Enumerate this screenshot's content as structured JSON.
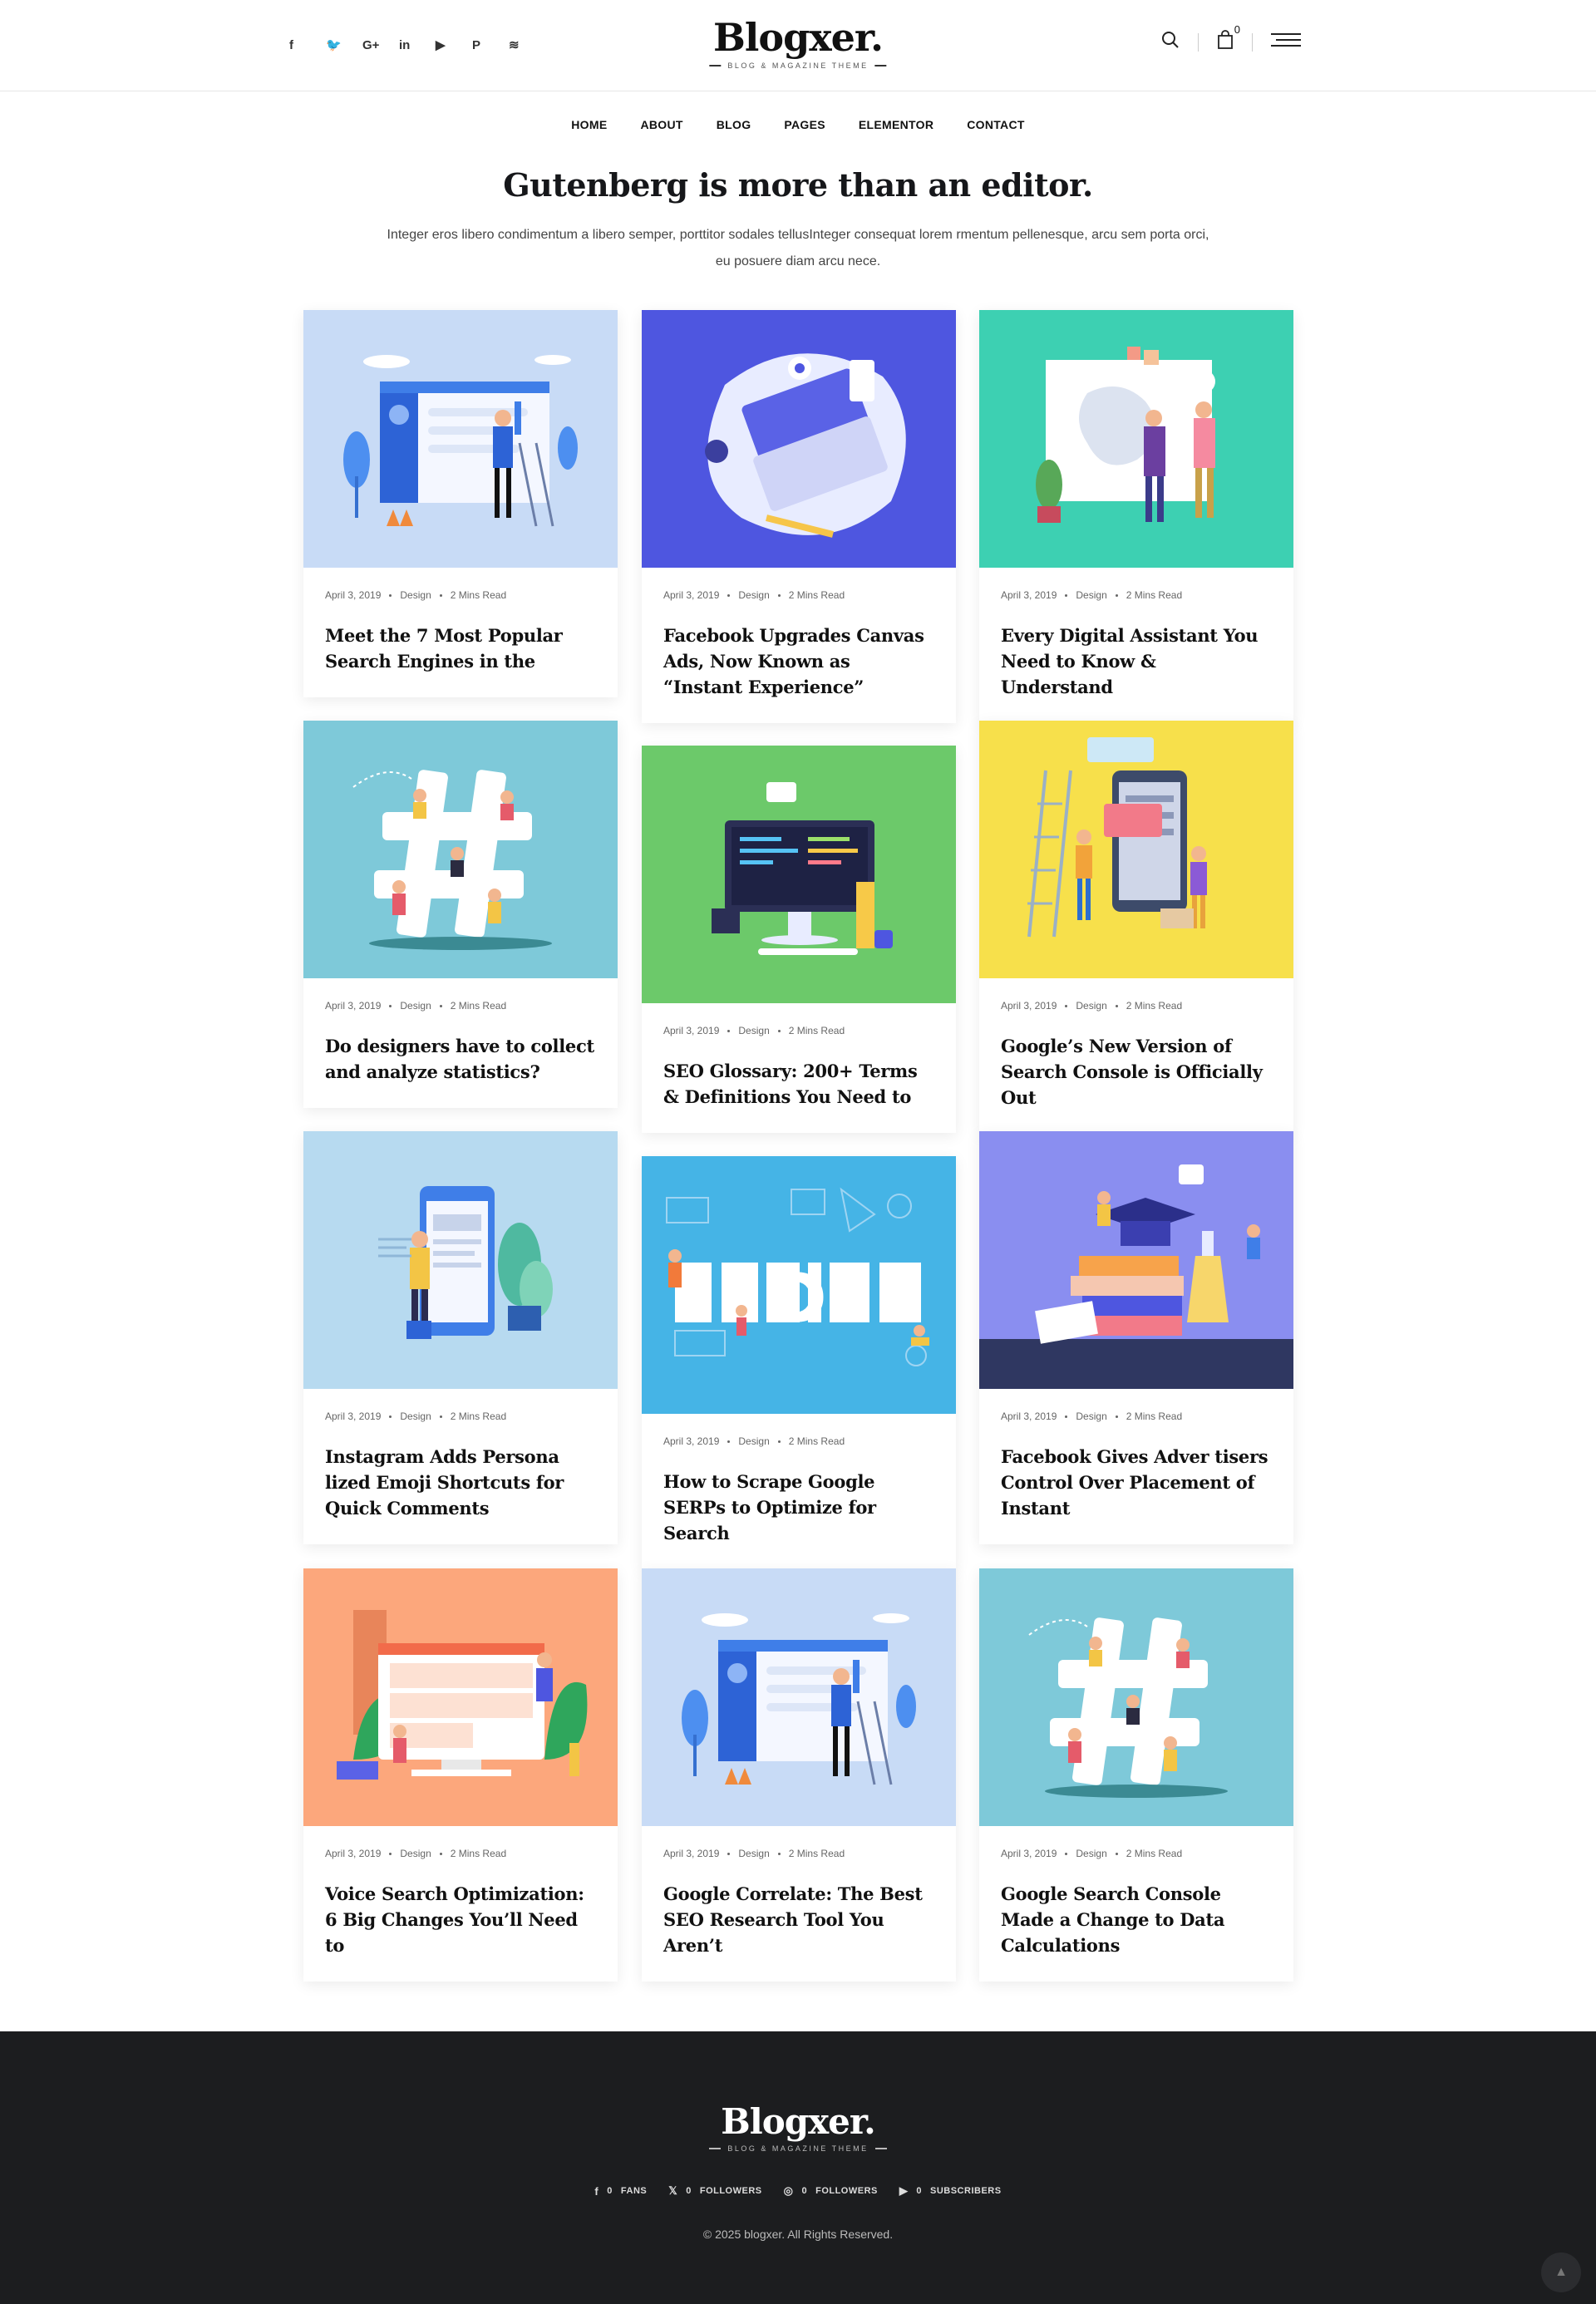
{
  "header": {
    "social_icons": [
      "facebook-icon",
      "twitter-icon",
      "google-plus-icon",
      "linkedin-icon",
      "youtube-icon",
      "pinterest-icon",
      "rss-icon"
    ],
    "social_glyphs": [
      "f",
      "🐦",
      "G+",
      "in",
      "▶",
      "P",
      "≋"
    ],
    "logo": "Blogxer.",
    "logo_tagline": "BLOG & MAGAZINE THEME",
    "cart_count": "0"
  },
  "nav": [
    "HOME",
    "ABOUT",
    "BLOG",
    "PAGES",
    "ELEMENTOR",
    "CONTACT"
  ],
  "hero": {
    "title": "Gutenberg is more than an editor.",
    "text": "Integer eros libero condimentum a libero semper, porttitor sodales tellusInteger consequat lorem rmentum pellenesque, arcu sem porta orci, eu posuere diam arcu nece."
  },
  "posts": [
    {
      "date": "April 3, 2019",
      "category": "Design",
      "read": "2 Mins Read",
      "title": "Meet the 7 Most Popular Search Engines in the",
      "thumb_color": "#c8dbf6",
      "art": "browser-painter"
    },
    {
      "date": "April 3, 2019",
      "category": "Design",
      "read": "2 Mins Read",
      "title": "Facebook Upgrades Canvas Ads, Now Known as “Instant Experience”",
      "thumb_color": "#4e56e0",
      "art": "laptop"
    },
    {
      "date": "April 3, 2019",
      "category": "Design",
      "read": "2 Mins Read",
      "title": "Every Digital Assistant You Need to Know & Understand",
      "thumb_color": "#3dd0b2",
      "art": "canvas-people"
    },
    {
      "date": "April 3, 2019",
      "category": "Design",
      "read": "2 Mins Read",
      "title": "Do designers have to collect and analyze statistics?",
      "thumb_color": "#7ec9d9",
      "art": "hashtag"
    },
    {
      "date": "April 3, 2019",
      "category": "Design",
      "read": "2 Mins Read",
      "title": "SEO Glossary: 200+ Terms & Definitions You Need to",
      "thumb_color": "#6cc96a",
      "art": "monitor-code"
    },
    {
      "date": "April 3, 2019",
      "category": "Design",
      "read": "2 Mins Read",
      "title": "Google’s New Version of Search Console is Officially Out",
      "thumb_color": "#f7e04b",
      "art": "phone-ladder"
    },
    {
      "date": "April 3, 2019",
      "category": "Design",
      "read": "2 Mins Read",
      "title": "Instagram Adds Persona lized Emoji Shortcuts for Quick Comments",
      "thumb_color": "#b7daf0",
      "art": "tablet-plant"
    },
    {
      "date": "April 3, 2019",
      "category": "Design",
      "read": "2 Mins Read",
      "title": "How to Scrape Google SERPs to Optimize for Search",
      "thumb_color": "#45b4e6",
      "art": "design-word"
    },
    {
      "date": "April 3, 2019",
      "category": "Design",
      "read": "2 Mins Read",
      "title": "Facebook Gives Adver tisers Control Over Placement of Instant",
      "thumb_color": "#8a8ef0",
      "art": "books"
    },
    {
      "date": "April 3, 2019",
      "category": "Design",
      "read": "2 Mins Read",
      "title": "Voice Search Optimization: 6 Big Changes You’ll Need to",
      "thumb_color": "#fca77c",
      "art": "monitor-people"
    },
    {
      "date": "April 3, 2019",
      "category": "Design",
      "read": "2 Mins Read",
      "title": "Google Correlate: The Best SEO Research Tool You Aren’t",
      "thumb_color": "#c8dbf6",
      "art": "browser-painter"
    },
    {
      "date": "April 3, 2019",
      "category": "Design",
      "read": "2 Mins Read",
      "title": "Google Search Console Made a Change to Data Calculations",
      "thumb_color": "#7ec9d9",
      "art": "hashtag"
    }
  ],
  "footer": {
    "logo": "Blogxer.",
    "logo_tagline": "BLOG & MAGAZINE THEME",
    "social": [
      {
        "icon": "facebook-icon",
        "glyph": "f",
        "count": "0",
        "label": "FANS"
      },
      {
        "icon": "x-icon",
        "glyph": "𝕏",
        "count": "0",
        "label": "FOLLOWERS"
      },
      {
        "icon": "instagram-icon",
        "glyph": "◎",
        "count": "0",
        "label": "FOLLOWERS"
      },
      {
        "icon": "youtube-icon",
        "glyph": "▶",
        "count": "0",
        "label": "SUBSCRIBERS"
      }
    ],
    "copyright": "© 2025 blogxer. All Rights Reserved."
  }
}
